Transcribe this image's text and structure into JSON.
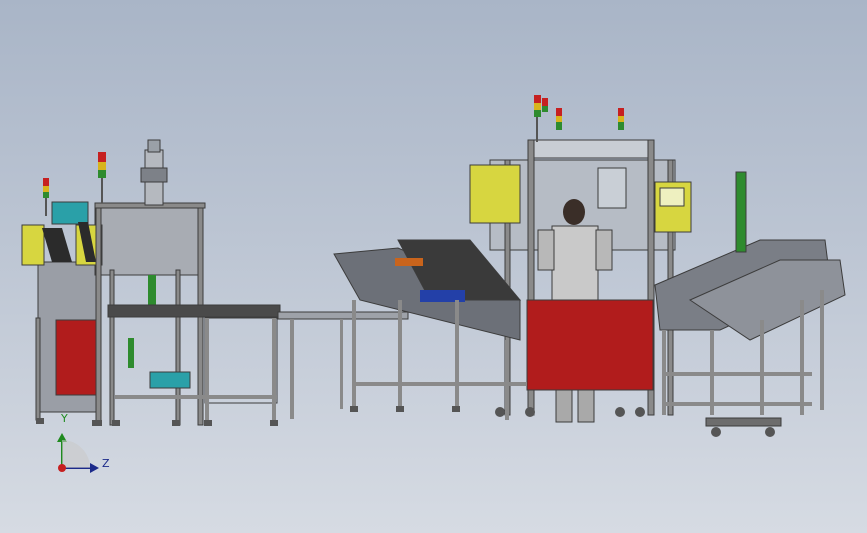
{
  "view": {
    "background_top": "#a9b5c7",
    "background_bottom": "#d6dbe3",
    "frame_color": "#8a8a8a",
    "accent_red": "#b11c1c",
    "accent_yellow": "#d7d640",
    "accent_teal": "#2aa0a8",
    "accent_green": "#2e8b2e"
  },
  "triad": {
    "y_label": "Y",
    "z_label": "Z",
    "icons": [
      "axis-y-arrow",
      "axis-z-arrow",
      "axis-x-origin"
    ]
  }
}
